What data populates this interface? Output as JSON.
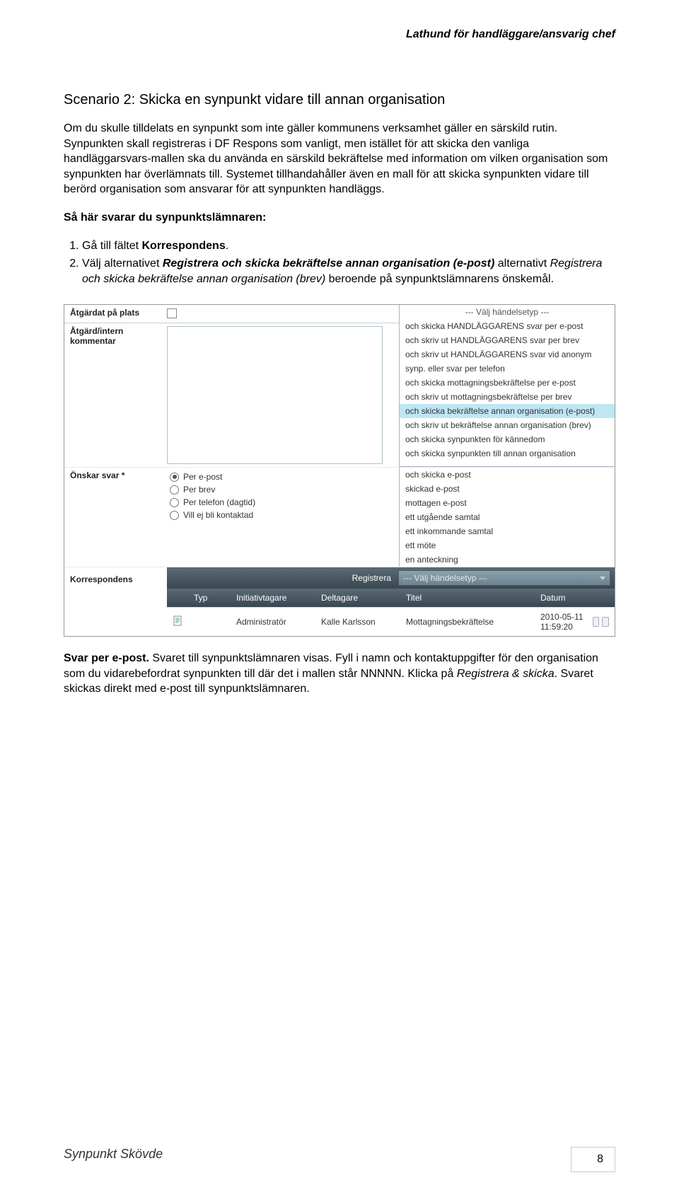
{
  "header": {
    "right": "Lathund för handläggare/ansvarig chef"
  },
  "title": "Scenario 2: Skicka en synpunkt vidare till annan organisation",
  "p1": "Om du skulle tilldelats en synpunkt som inte gäller kommunens verksamhet gäller en särskild rutin. Synpunkten skall registreras i DF Respons som vanligt, men istället för att skicka den vanliga handläggarsvars-mallen ska du använda en särskild bekräftelse med information om vilken organisation som synpunkten har överlämnats till. Systemet tillhandahåller även en mall för att skicka synpunkten vidare till berörd organisation som ansvarar för att synpunkten handläggs.",
  "p2_bold": "Så här svarar du synpunktslämnaren:",
  "list": {
    "i1_a": "Gå till fältet ",
    "i1_b": "Korrespondens",
    "i1_c": ".",
    "i2_a": "Välj alternativet ",
    "i2_b": "Registrera och skicka bekräftelse annan organisation (e-post)",
    "i2_c": " alternativt ",
    "i2_d": "Registrera och skicka bekräftelse annan organisation (brev)",
    "i2_e": " beroende på synpunktslämnarens önskemål."
  },
  "form": {
    "atgardat": "Åtgärdat på plats",
    "atgard_kommentar": "Åtgärd/intern kommentar",
    "onskar": "Önskar svar *",
    "korr": "Korrespondens",
    "radios": {
      "r1": "Per e-post",
      "r2": "Per brev",
      "r3": "Per telefon (dagtid)",
      "r4": "Vill ej bli kontaktad"
    }
  },
  "dropdown": {
    "head": "--- Välj händelsetyp ---",
    "items": [
      "och skicka HANDLÄGGARENS svar per e-post",
      "och skriv ut HANDLÄGGARENS svar per brev",
      "och skriv ut HANDLÄGGARENS svar vid anonym",
      "synp. eller svar per telefon",
      "och skicka mottagningsbekräftelse per e-post",
      "och skriv ut mottagningsbekräftelse per brev",
      "och skicka bekräftelse annan organisation (e-post)",
      "och skriv ut bekräftelse annan organisation (brev)",
      "och skicka synpunkten för kännedom",
      "och skicka synpunkten till annan organisation"
    ],
    "items2": [
      "och skicka e-post",
      "skickad e-post",
      "mottagen e-post",
      "ett utgående samtal",
      "ett inkommande samtal",
      "ett möte",
      "en anteckning"
    ]
  },
  "regbar": {
    "label": "Registrera",
    "select": "--- Välj händelsetyp ---"
  },
  "table": {
    "h_typ": "Typ",
    "h_init": "Initiativtagare",
    "h_delt": "Deltagare",
    "h_titel": "Titel",
    "h_datum": "Datum",
    "row": {
      "init": "Administratör",
      "delt": "Kalle Karlsson",
      "titel": "Mottagningsbekräftelse",
      "datum": "2010-05-11 11:59:20"
    }
  },
  "p3_a": "Svar per e-post.",
  "p3_b": " Svaret till synpunktslämnaren visas. Fyll i namn och kontaktuppgifter för den organisation som du vidarebefordrat synpunkten till där det i mallen står NNNNN. Klicka på ",
  "p3_c": "Registrera & skicka",
  "p3_d": ". Svaret skickas direkt med e-post till synpunktslämnaren.",
  "footer": {
    "left": "Synpunkt Skövde",
    "page": "8"
  }
}
